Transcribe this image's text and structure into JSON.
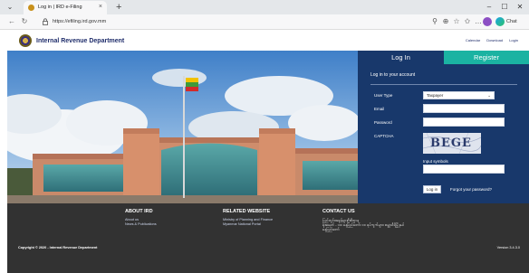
{
  "browser": {
    "tab_title": "Log in | IRD e-Filing",
    "tab_close": "×",
    "new_tab": "+",
    "url": "https://efiling.ird.gov.mm",
    "minimize": "–",
    "maximize": "☐",
    "close": "✕",
    "chat_label": "Chat"
  },
  "site": {
    "title": "Internal Revenue Department",
    "top_links": [
      "Calendar",
      "Download",
      "Login"
    ]
  },
  "login": {
    "tab_login": "Log In",
    "tab_register": "Register",
    "heading": "Log in to your account",
    "user_type_label": "User Type",
    "user_type_value": "Taxpayer",
    "email_label": "Email",
    "password_label": "Password",
    "captcha_label": "CAPTCHA",
    "captcha_text": "BEGE",
    "input_symbols_label": "Input symbols",
    "login_button": "Log in",
    "forgot_link": "Forgot your password?"
  },
  "footer": {
    "about_heading": "ABOUT IRD",
    "about_links": [
      "About us",
      "News & Publications"
    ],
    "related_heading": "RELATED WEBSITE",
    "related_links": [
      "Ministry of Planning and Finance",
      "Myanmar National Portal"
    ],
    "contact_heading": "CONTACT US",
    "contact_lines": [
      "ပြည်တွင်းအခွန်များဦးစီးဌာန",
      "ရုံးအမှတ် - ၁၀၊ နေပြည်တော်၊ ၁၀ ရပ်ကွက်များ၊ ဇမ္ဗူသီရိမြို့နယ်",
      "နေပြည်တော်"
    ],
    "copyright": "Copyright © 2020 - Internal Revenue Department",
    "version": "Version 3.4.3.0"
  },
  "colors": {
    "panel": "#18386b",
    "register_tab": "#1bb3a2",
    "footer": "#323232",
    "header_title": "#1f2d6b"
  }
}
